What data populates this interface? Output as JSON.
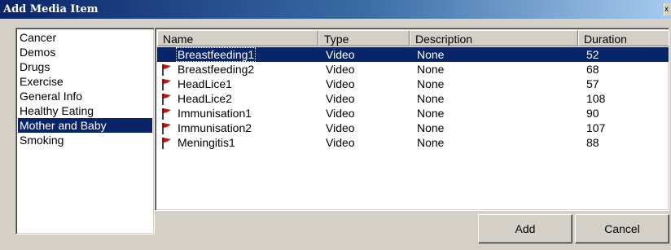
{
  "window": {
    "title": "Add Media Item",
    "close_label": "x"
  },
  "categories": {
    "items": [
      {
        "label": "Cancer",
        "selected": false
      },
      {
        "label": "Demos",
        "selected": false
      },
      {
        "label": "Drugs",
        "selected": false
      },
      {
        "label": "Exercise",
        "selected": false
      },
      {
        "label": "General Info",
        "selected": false
      },
      {
        "label": "Healthy Eating",
        "selected": false
      },
      {
        "label": "Mother and Baby",
        "selected": true
      },
      {
        "label": "Smoking",
        "selected": false
      }
    ]
  },
  "media": {
    "columns": [
      "Name",
      "Type",
      "Description",
      "Duration"
    ],
    "rows": [
      {
        "name": "Breastfeeding1",
        "type": "Video",
        "description": "None",
        "duration": "52",
        "selected": true,
        "icon": "none"
      },
      {
        "name": "Breastfeeding2",
        "type": "Video",
        "description": "None",
        "duration": "68",
        "selected": false,
        "icon": "red-flag-icon"
      },
      {
        "name": "HeadLice1",
        "type": "Video",
        "description": "None",
        "duration": "57",
        "selected": false,
        "icon": "red-flag-icon"
      },
      {
        "name": "HeadLice2",
        "type": "Video",
        "description": "None",
        "duration": "108",
        "selected": false,
        "icon": "red-flag-icon"
      },
      {
        "name": "Immunisation1",
        "type": "Video",
        "description": "None",
        "duration": "90",
        "selected": false,
        "icon": "red-flag-icon"
      },
      {
        "name": "Immunisation2",
        "type": "Video",
        "description": "None",
        "duration": "107",
        "selected": false,
        "icon": "red-flag-icon"
      },
      {
        "name": "Meningitis1",
        "type": "Video",
        "description": "None",
        "duration": "88",
        "selected": false,
        "icon": "red-flag-icon"
      }
    ]
  },
  "buttons": {
    "add": "Add",
    "cancel": "Cancel"
  },
  "colors": {
    "selection": "#0a246a",
    "flag": "#d01010",
    "dialog_bg": "#d4d0c8"
  }
}
